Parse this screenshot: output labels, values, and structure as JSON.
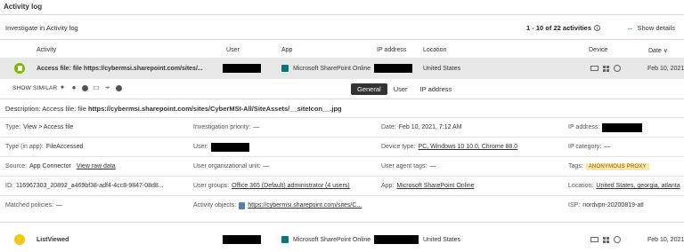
{
  "header": {
    "title": "Activity log",
    "investigate": "Investigate in Activity log",
    "count": "1 - 10 of 22 activities",
    "info_icon": "info-icon",
    "show_details": "Show details"
  },
  "columns": [
    "Activity",
    "User",
    "App",
    "IP address",
    "Location",
    "Device",
    "Date ∨"
  ],
  "rows": [
    {
      "activity": "Access file: file https://cybermsi.sharepoint.com/sites/...",
      "app": "Microsoft SharePoint Online",
      "location": "United States",
      "date": "Feb 10, 2021,",
      "icon_color": "#7fba00"
    },
    {
      "activity": "ListViewed",
      "app": "Microsoft SharePoint Online",
      "location": "United States",
      "date": "Feb 10, 2021,",
      "icon_color": "#f2c811"
    }
  ],
  "similar": {
    "label": "SHOW SIMILAR",
    "tabs": [
      "General",
      "User",
      "IP address"
    ]
  },
  "description": {
    "prefix": "Description:  Access file: file ",
    "bold": "https://cybermsi.sharepoint.com/sites/CyberMSI-All/SiteAssets/__siteIcon__.jpg"
  },
  "details": {
    "type": {
      "label": "Type:",
      "value": "View > Access file"
    },
    "investigation_priority": {
      "label": "Investigation priority:",
      "value": "—"
    },
    "date": {
      "label": "Date:",
      "value": "Feb 10, 2021, 7:12 AM"
    },
    "ip_address": {
      "label": "IP address:"
    },
    "type_in_app": {
      "label": "Type (in app):",
      "value": "FileAccessed"
    },
    "user": {
      "label": "User:"
    },
    "device_type": {
      "label": "Device type:",
      "value": "PC, Windows 10 10.0, Chrome 88.0"
    },
    "ip_category": {
      "label": "IP category:",
      "value": "—"
    },
    "source": {
      "label": "Source:",
      "value": "App Connector",
      "link": "View raw data"
    },
    "org_unit": {
      "label": "User organizational unit:",
      "value": "—"
    },
    "user_agent_tags": {
      "label": "User agent tags:",
      "value": "—"
    },
    "tags": {
      "label": "Tags:",
      "value": "ANONYMOUS PROXY"
    },
    "id": {
      "label": "ID:",
      "value": "116967303_20892_a469bf38-adf4-4cc8-9847-08d8..."
    },
    "user_groups": {
      "label": "User groups:",
      "value": "Office 365 (Default) administrator (4 users)"
    },
    "app": {
      "label": "App:",
      "value": "Microsoft SharePoint Online"
    },
    "location": {
      "label": "Location:",
      "value": "United States, georgia, atlanta"
    },
    "matched_policies": {
      "label": "Matched policies:",
      "value": "—"
    },
    "activity_objects": {
      "label": "Activity objects:",
      "value": "https://cybermsi.sharepoint.com/sites/C..."
    },
    "isp": {
      "label": "ISP:",
      "value": "nordvpn-20200819-atl"
    }
  }
}
